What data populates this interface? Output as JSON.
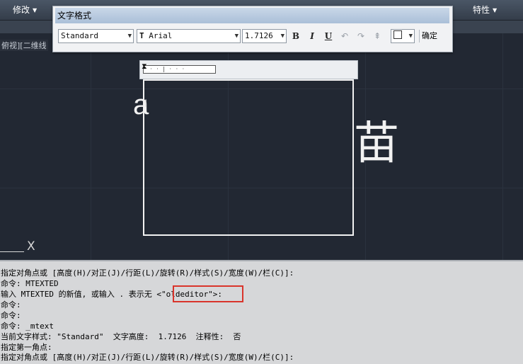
{
  "menubar": {
    "modify_label": "修改",
    "properties_label": "特性"
  },
  "viewport_label": "俯视][二维线",
  "dialog": {
    "title": "文字格式",
    "style_value": "Standard",
    "font_value": "Arial",
    "font_prefix": "T",
    "height_value": "1.7126",
    "bold_label": "B",
    "italic_label": "I",
    "underline_label": "U",
    "confirm_label": "确定"
  },
  "editor": {
    "ruler_ticks": "· · · | · · ·",
    "typed_text": "a",
    "cursor_glyph": "I",
    "preview_glyph": "苗",
    "ucs_x": "X"
  },
  "command_window": {
    "lines": [
      "指定对角点或 [高度(H)/对正(J)/行距(L)/旋转(R)/样式(S)/宽度(W)/栏(C)]:",
      "命令: MTEXTED",
      "输入 MTEXTED 的新值, 或输入 . 表示无 <\"oldeditor\">:",
      "命令:",
      "命令:",
      "命令: _mtext",
      "当前文字样式: \"Standard\"  文字高度:  1.7126  注释性:  否",
      "指定第一角点:",
      "指定对角点或 [高度(H)/对正(J)/行距(L)/旋转(R)/样式(S)/宽度(W)/栏(C)]:"
    ],
    "highlight_color": "#d9342b"
  }
}
